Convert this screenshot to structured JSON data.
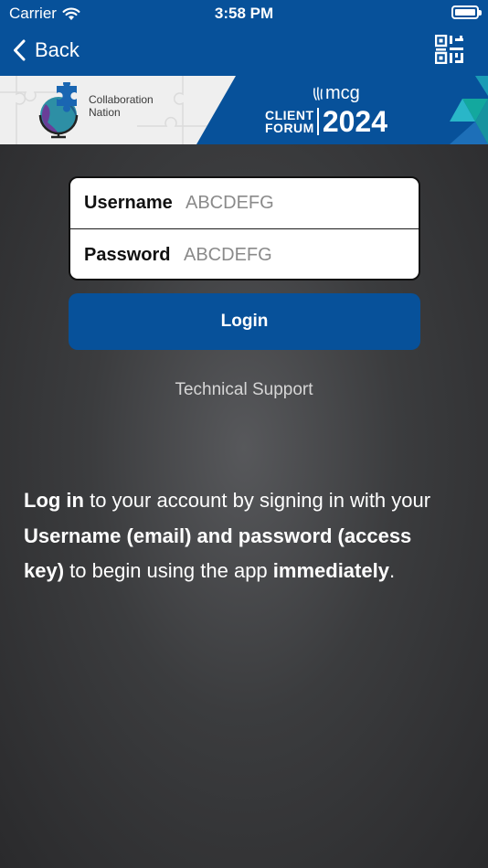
{
  "status": {
    "carrier": "Carrier",
    "time": "3:58 PM"
  },
  "nav": {
    "back_label": "Back"
  },
  "banner": {
    "logo_line1": "Collaboration",
    "logo_line2": "Nation",
    "mcg": "mcg",
    "client": "CLIENT",
    "forum": "FORUM",
    "year": "2024"
  },
  "form": {
    "username_label": "Username",
    "username_placeholder": "ABCDEFG",
    "password_label": "Password",
    "password_placeholder": "ABCDEFG"
  },
  "login_label": "Login",
  "tech_support": "Technical Support",
  "info": {
    "p1_bold": "Log in",
    "p2": " to your account by signing in with your ",
    "p3_bold": "Username (email) and password (access key)",
    "p4": " to begin using the app ",
    "p5_bold": "immediately",
    "p6": "."
  },
  "colors": {
    "brand_blue": "#07519a",
    "background": "#2f2f31"
  },
  "icons": [
    "wifi-icon",
    "battery-icon",
    "chevron-left-icon",
    "qr-code-icon",
    "puzzle-globe-icon"
  ]
}
